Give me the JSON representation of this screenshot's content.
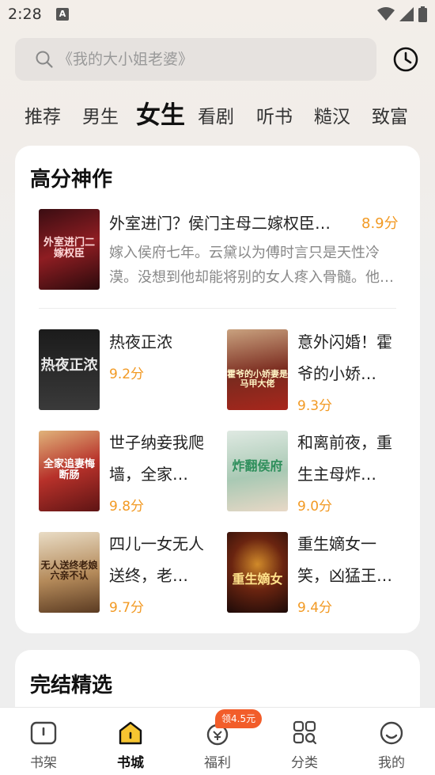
{
  "status_bar": {
    "time": "2:28",
    "notification_letter": "A"
  },
  "search": {
    "placeholder": "《我的大小姐老婆》"
  },
  "tabs": [
    {
      "label": "推荐"
    },
    {
      "label": "男生"
    },
    {
      "label": "女生",
      "active": true
    },
    {
      "label": "看剧"
    },
    {
      "label": "听书"
    },
    {
      "label": "糙汉"
    },
    {
      "label": "致富"
    }
  ],
  "section_high_score": {
    "title": "高分神作",
    "featured": {
      "title": "外室进门？侯门主母二嫁权臣…",
      "score": "8.9分",
      "description": "嫁入侯府七年。云黛以为傅时言只是天性冷漠。没想到他却能将别的女人疼入骨髓。他…",
      "cover_text": "外室进门二嫁权臣"
    },
    "books": [
      {
        "title": "热夜正浓",
        "score": "9.2分",
        "cover_text": "热夜正浓"
      },
      {
        "title": "意外闪婚！霍爷的小娇…",
        "score": "9.3分",
        "cover_text": "霍爷的小娇妻是马甲大佬"
      },
      {
        "title": "世子纳妾我爬墙，全家…",
        "score": "9.8分",
        "cover_text": "全家追妻悔断肠"
      },
      {
        "title": "和离前夜，重生主母炸…",
        "score": "9.0分",
        "cover_text": "炸翻侯府"
      },
      {
        "title": "四儿一女无人送终，老…",
        "score": "9.7分",
        "cover_text": "无人送终老娘六亲不认"
      },
      {
        "title": "重生嫡女一笑，凶猛王…",
        "score": "9.4分",
        "cover_text": "重生嫡女"
      }
    ]
  },
  "section_completed": {
    "title": "完结精选"
  },
  "promo_badge": "领4.5元",
  "nav": [
    {
      "label": "书架",
      "icon": "bookshelf-icon"
    },
    {
      "label": "书城",
      "icon": "bookstore-icon",
      "active": true
    },
    {
      "label": "福利",
      "icon": "welfare-icon"
    },
    {
      "label": "分类",
      "icon": "category-icon"
    },
    {
      "label": "我的",
      "icon": "profile-icon"
    }
  ],
  "colors": {
    "accent_score": "#f29a24",
    "promo": "#f25d2a",
    "active_nav": "#f7c531"
  }
}
